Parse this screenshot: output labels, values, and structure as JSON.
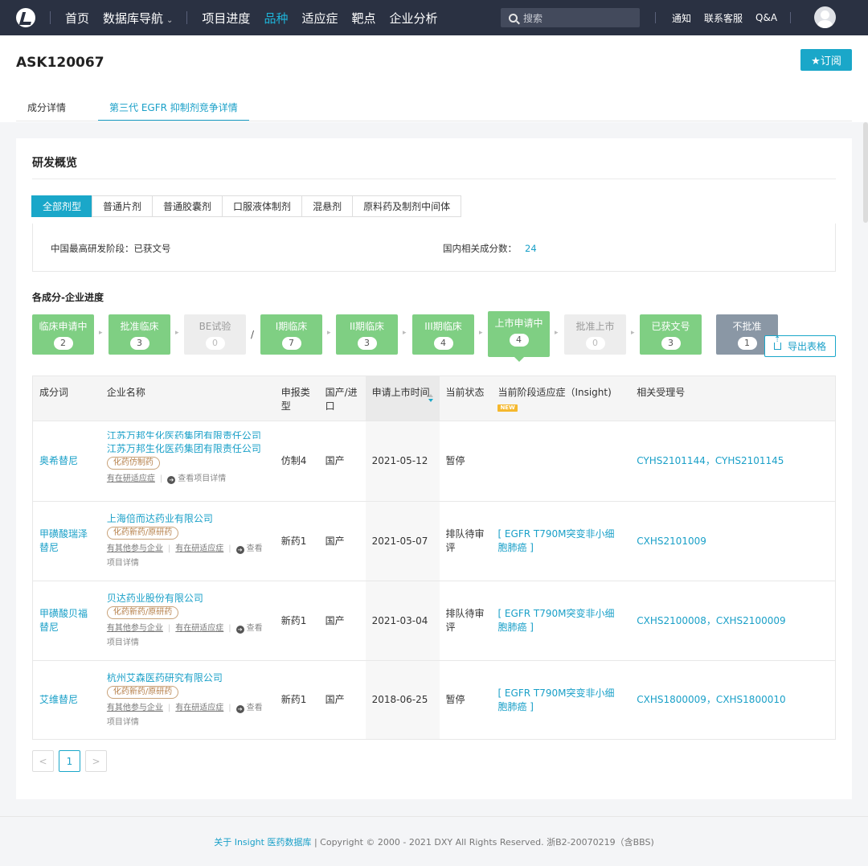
{
  "nav": {
    "items": [
      "首页",
      "数据库导航",
      "项目进度",
      "品种",
      "适应症",
      "靶点",
      "企业分析"
    ],
    "active_index": 3,
    "search_placeholder": "搜索",
    "right_links": [
      "通知",
      "联系客服",
      "Q&A"
    ]
  },
  "header": {
    "title": "ASK120067",
    "subscribe_label": "★订阅",
    "tabs": [
      "成分详情",
      "第三代 EGFR 抑制剂竞争详情"
    ],
    "active_tab": 1
  },
  "overview": {
    "title": "研发概览",
    "filters": [
      "全部剂型",
      "普通片剂",
      "普通胶囊剂",
      "口服液体制剂",
      "混悬剂",
      "原料药及制剂中间体"
    ],
    "highest_stage": "中国最高研发阶段：已获文号",
    "count_label": "国内相关成分数：",
    "count_value": "24"
  },
  "progress": {
    "title": "各成分-企业进度",
    "stages": [
      {
        "label": "临床申请中",
        "count": "2"
      },
      {
        "label": "批准临床",
        "count": "3"
      },
      {
        "label": "BE试验",
        "count": "0"
      },
      {
        "label": "I期临床",
        "count": "7"
      },
      {
        "label": "II期临床",
        "count": "3"
      },
      {
        "label": "III期临床",
        "count": "4"
      },
      {
        "label": "上市申请中",
        "count": "4"
      },
      {
        "label": "批准上市",
        "count": "0"
      },
      {
        "label": "已获文号",
        "count": "3"
      },
      {
        "label": "不批准",
        "count": "1"
      }
    ],
    "separator": "/",
    "export_label": "导出表格"
  },
  "table": {
    "headers": [
      "成分词",
      "企业名称",
      "申报类型",
      "国产/进口",
      "申请上市时间",
      "当前状态",
      "当前阶段适应症（Insight)",
      "相关受理号"
    ],
    "new_badge": "NEW",
    "rows": [
      {
        "ingredient": "奥希替尼",
        "ghost_company": "江苏万邦生化医药集团有限责任公司",
        "company": "江苏万邦生化医药集团有限责任公司",
        "tag": "化药仿制药",
        "op1": "有在研适应症",
        "op2": "查看项目详情",
        "op3": "",
        "type": "仿制4",
        "origin": "国产",
        "date": "2021-05-12",
        "status": "暂停",
        "indication": "",
        "numbers": "CYHS2101144，CYHS2101145"
      },
      {
        "ingredient": "甲磺酸瑞泽替尼",
        "ghost_company": "",
        "company": "上海倍而达药业有限公司",
        "tag": "化药新药/原研药",
        "op1": "有其他参与企业",
        "op2": "有在研适应症",
        "op3": "查看项目详情",
        "type": "新药1",
        "origin": "国产",
        "date": "2021-05-07",
        "status": "排队待审评",
        "indication": "[ EGFR T790M突变非小细胞肺癌 ]",
        "numbers": "CXHS2101009"
      },
      {
        "ingredient": "甲磺酸贝福替尼",
        "ghost_company": "",
        "company": "贝达药业股份有限公司",
        "tag": "化药新药/原研药",
        "op1": "有其他参与企业",
        "op2": "有在研适应症",
        "op3": "查看项目详情",
        "type": "新药1",
        "origin": "国产",
        "date": "2021-03-04",
        "status": "排队待审评",
        "indication": "[ EGFR T790M突变非小细胞肺癌 ]",
        "numbers": "CXHS2100008，CXHS2100009"
      },
      {
        "ingredient": "艾维替尼",
        "ghost_company": "",
        "company": "杭州艾森医药研究有限公司",
        "tag": "化药新药/原研药",
        "op1": "有其他参与企业",
        "op2": "有在研适应症",
        "op3": "查看项目详情",
        "type": "新药1",
        "origin": "国产",
        "date": "2018-06-25",
        "status": "暂停",
        "indication": "[ EGFR T790M突变非小细胞肺癌 ]",
        "numbers": "CXHS1800009，CXHS1800010"
      }
    ]
  },
  "pager": {
    "prev": "<",
    "current": "1",
    "next": ">"
  },
  "footer": {
    "link": "关于 Insight 医药数据库",
    "text": " | Copyright © 2000 - 2021 DXY All Rights Reserved. 浙B2-20070219（含BBS)"
  }
}
